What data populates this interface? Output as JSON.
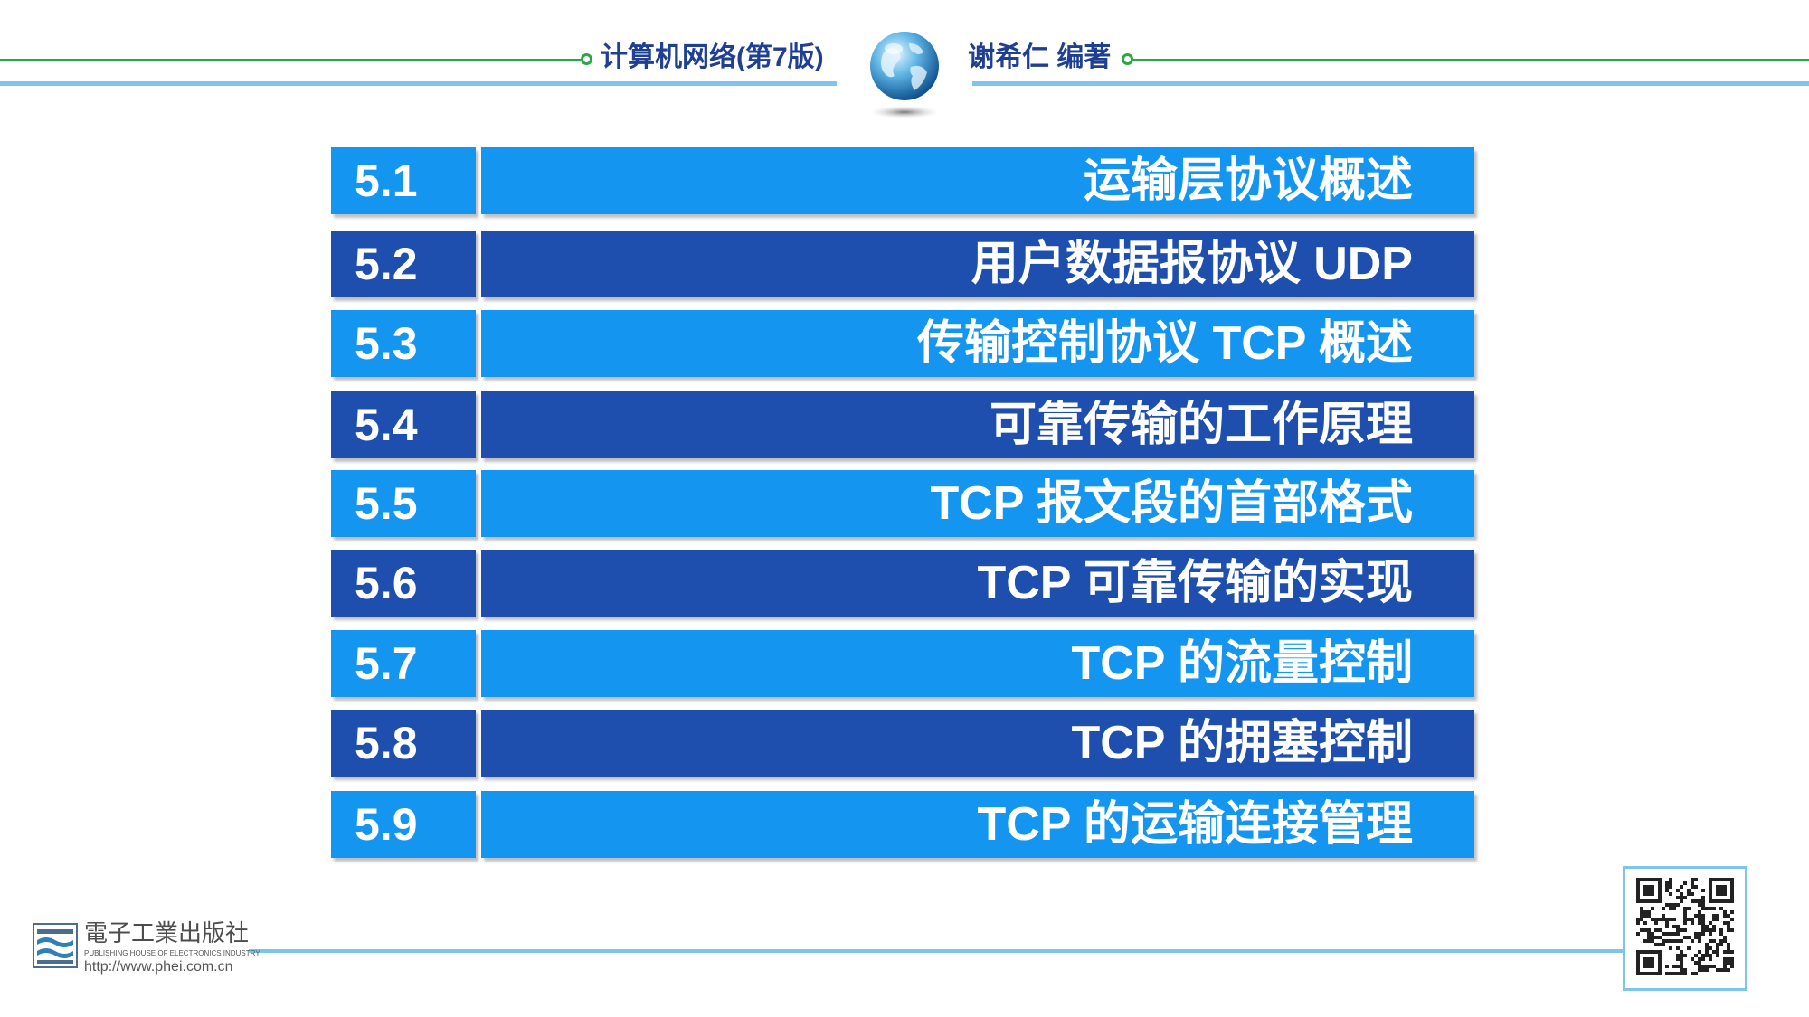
{
  "header": {
    "book_title": "计算机网络(第7版)",
    "author": "谢希仁 编著"
  },
  "chapters": [
    {
      "num": "5.1",
      "title": "运输层协议概述",
      "style": "light"
    },
    {
      "num": "5.2",
      "title": "用户数据报协议 UDP",
      "style": "dark"
    },
    {
      "num": "5.3",
      "title": "传输控制协议 TCP 概述",
      "style": "light"
    },
    {
      "num": "5.4",
      "title": "可靠传输的工作原理",
      "style": "dark"
    },
    {
      "num": "5.5",
      "title": "TCP 报文段的首部格式",
      "style": "light"
    },
    {
      "num": "5.6",
      "title": "TCP 可靠传输的实现",
      "style": "dark"
    },
    {
      "num": "5.7",
      "title": "TCP 的流量控制",
      "style": "light"
    },
    {
      "num": "5.8",
      "title": "TCP 的拥塞控制",
      "style": "dark"
    },
    {
      "num": "5.9",
      "title": "TCP 的运输连接管理",
      "style": "light"
    }
  ],
  "publisher": {
    "name_cn": "電子工業出版社",
    "name_en": "PUBLISHING HOUSE OF ELECTRONICS INDUSTRY",
    "url": "http://www.phei.com.cn"
  },
  "colors": {
    "light_row": "#1496f0",
    "dark_row": "#1e4fae",
    "header_green": "#27a844",
    "header_blue": "#7fc4ec",
    "header_text": "#1f3f93"
  },
  "icons": {
    "globe": "globe-icon",
    "publisher_logo": "publisher-logo-icon",
    "qr": "qr-code-icon"
  }
}
